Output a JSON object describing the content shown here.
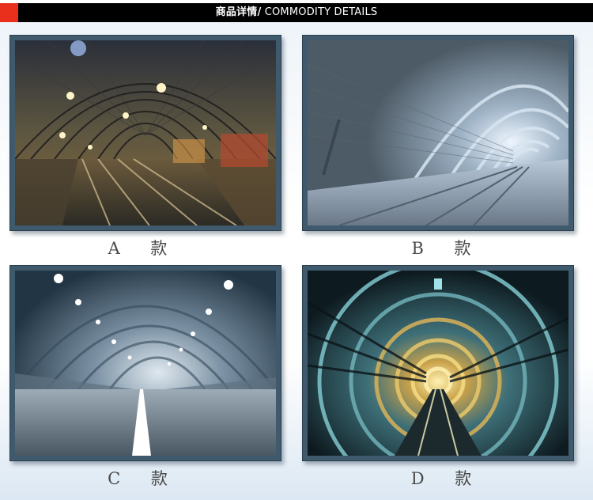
{
  "header": {
    "title_cn": "商品详情/",
    "title_en": " COMMODITY DETAILS",
    "bar_color": "#000000",
    "accent_color": "#e8301c"
  },
  "products": [
    {
      "caption": "A 款",
      "image": "train-station-image"
    },
    {
      "caption": "B 款",
      "image": "brick-tunnel-image"
    },
    {
      "caption": "C 款",
      "image": "road-tunnel-image"
    },
    {
      "caption": "D 款",
      "image": "subway-tunnel-image"
    }
  ]
}
